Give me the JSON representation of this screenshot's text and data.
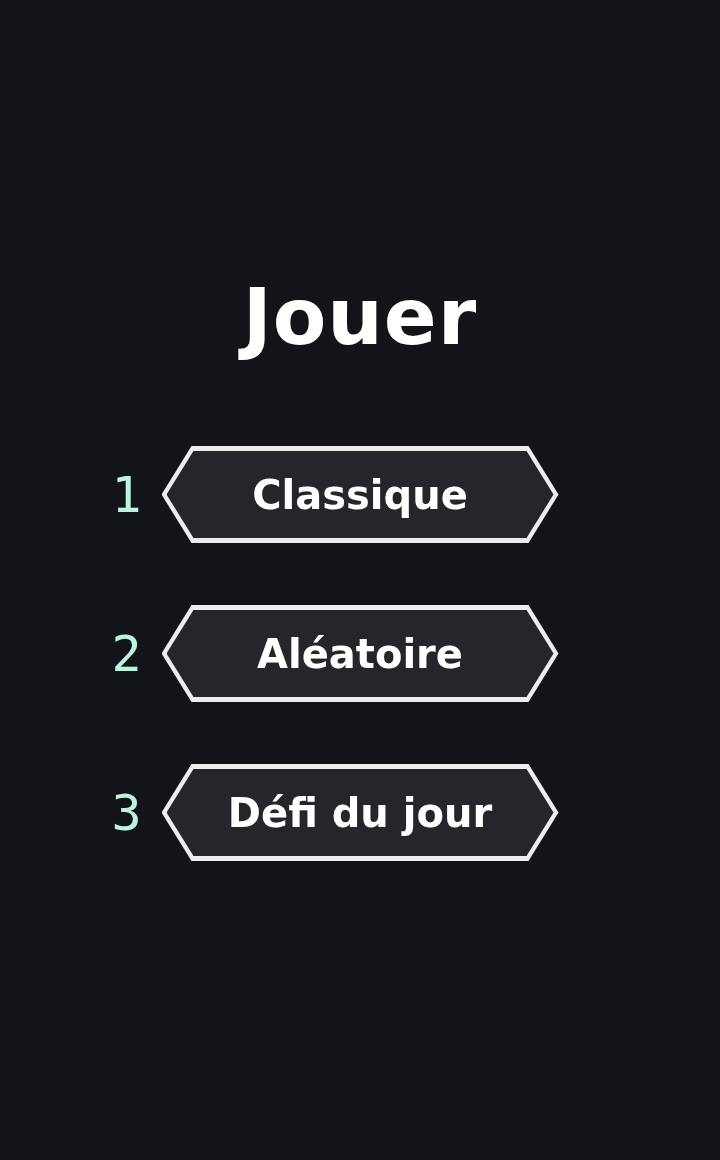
{
  "title": "Jouer",
  "modes": [
    {
      "number": "1",
      "label": "Classique"
    },
    {
      "number": "2",
      "label": "Aléatoire"
    },
    {
      "number": "3",
      "label": "Défi du jour"
    }
  ]
}
